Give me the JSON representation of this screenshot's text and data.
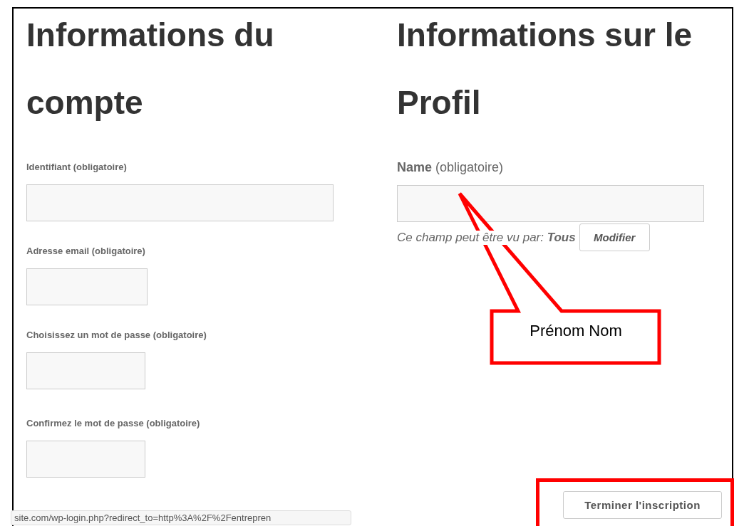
{
  "account": {
    "heading": "Informations du compte",
    "fields": [
      {
        "label": "Identifiant (obligatoire)"
      },
      {
        "label": "Adresse email (obligatoire)"
      },
      {
        "label": "Choisissez un mot de passe (obligatoire)"
      },
      {
        "label": "Confirmez le mot de passe (obligatoire)"
      }
    ]
  },
  "profile": {
    "heading": "Informations sur le Profil",
    "field": {
      "label": "**Name** (obligatoire)",
      "visibility": "Ce champ peut être vu par: **Tous**",
      "button": "Modifier"
    }
  },
  "callout": {
    "text": "Prénom Nom"
  },
  "submit": {
    "label": "Terminer l'inscription"
  },
  "status_bar": {
    "url": "site.com/wp-login.php?redirect_to=http%3A%2F%2Fentrepren"
  }
}
